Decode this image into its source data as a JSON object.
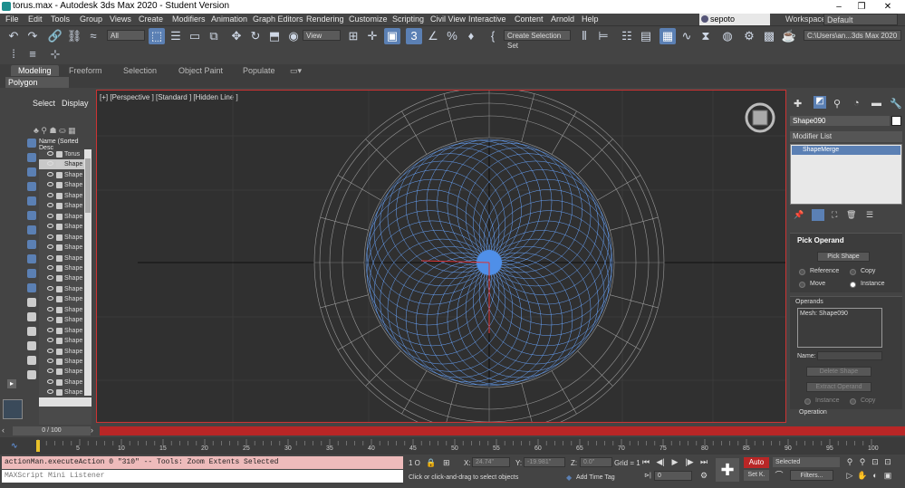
{
  "window": {
    "title": "torus.max - Autodesk 3ds Max 2020 - Student Version"
  },
  "menu": {
    "items": [
      "File",
      "Edit",
      "Tools",
      "Group",
      "Views",
      "Create",
      "Modifiers",
      "Animation",
      "Graph Editors",
      "Rendering",
      "Customize",
      "Scripting",
      "Civil View",
      "Interactive",
      "Content",
      "Arnold",
      "Help"
    ],
    "user": "sepoto",
    "workspaces_label": "Workspaces:",
    "workspace": "Default"
  },
  "toolbar": {
    "selection_filter": "All",
    "reference_coord": "View",
    "named_selection": "Create Selection Set",
    "project_path": "C:\\Users\\an...3ds Max 2020"
  },
  "ribbon": {
    "tabs": [
      "Modeling",
      "Freeform",
      "Selection",
      "Object Paint",
      "Populate"
    ],
    "active_tab": "Modeling",
    "sub_panel": "Polygon Modeling"
  },
  "scene_explorer": {
    "tabs": [
      "Select",
      "Display"
    ],
    "column_header": "Name (Sorted Desc",
    "rows": [
      "Torus",
      "Shape",
      "Shape",
      "Shape",
      "Shape",
      "Shape",
      "Shape",
      "Shape",
      "Shape",
      "Shape",
      "Shape",
      "Shape",
      "Shape",
      "Shape",
      "Shape",
      "Shape",
      "Shape",
      "Shape",
      "Shape",
      "Shape",
      "Shape",
      "Shape",
      "Shape",
      "Shape",
      "Shape"
    ],
    "selected_index": 1
  },
  "viewport": {
    "label": "[+] [Perspective ] [Standard ] [Hidden Line ]"
  },
  "command_panel": {
    "object_name": "Shape090",
    "modifier_list_label": "Modifier List",
    "stack_item": "ShapeMerge",
    "pick_operand": {
      "title": "Pick Operand",
      "pick_button": "Pick Shape",
      "radios": [
        "Reference",
        "Copy",
        "Move",
        "Instance"
      ],
      "selected_radio": "Instance"
    },
    "operands": {
      "title": "Operands",
      "list_item": "Mesh: Shape090",
      "name_label": "Name:",
      "delete_button": "Delete Shape",
      "extract_button": "Extract Operand",
      "radios": [
        "Instance",
        "Copy"
      ]
    },
    "operation_title": "Operation"
  },
  "timeline": {
    "slider": "0 / 100",
    "ticks": [
      "0",
      "5",
      "10",
      "15",
      "20",
      "25",
      "30",
      "35",
      "40",
      "45",
      "50",
      "55",
      "60",
      "65",
      "70",
      "75",
      "80",
      "85",
      "90",
      "95",
      "100"
    ]
  },
  "status": {
    "maxscript_output": "actionMan.executeAction 0 \"310\"  -- Tools: Zoom Extents Selected",
    "maxscript_input": "MAXScript Mini Listener",
    "selection_count": "1 O",
    "x_label": "X:",
    "x_value": "24.74\"",
    "y_label": "Y:",
    "y_value": "-19.981\"",
    "z_label": "Z:",
    "z_value": "0.0\"",
    "grid": "Grid = 1",
    "prompt": "Click or click-and-drag to select objects",
    "add_time_tag": "Add Time Tag",
    "frame": "0",
    "auto_key": "Auto",
    "set_key": "Set K.",
    "key_filter": "Selected",
    "filters": "Filters..."
  },
  "colors": {
    "accent": "#5b80b4",
    "viewport_border": "#cc3333",
    "timeline_red": "#b92626",
    "mesh_blue": "#6aa6ff"
  }
}
